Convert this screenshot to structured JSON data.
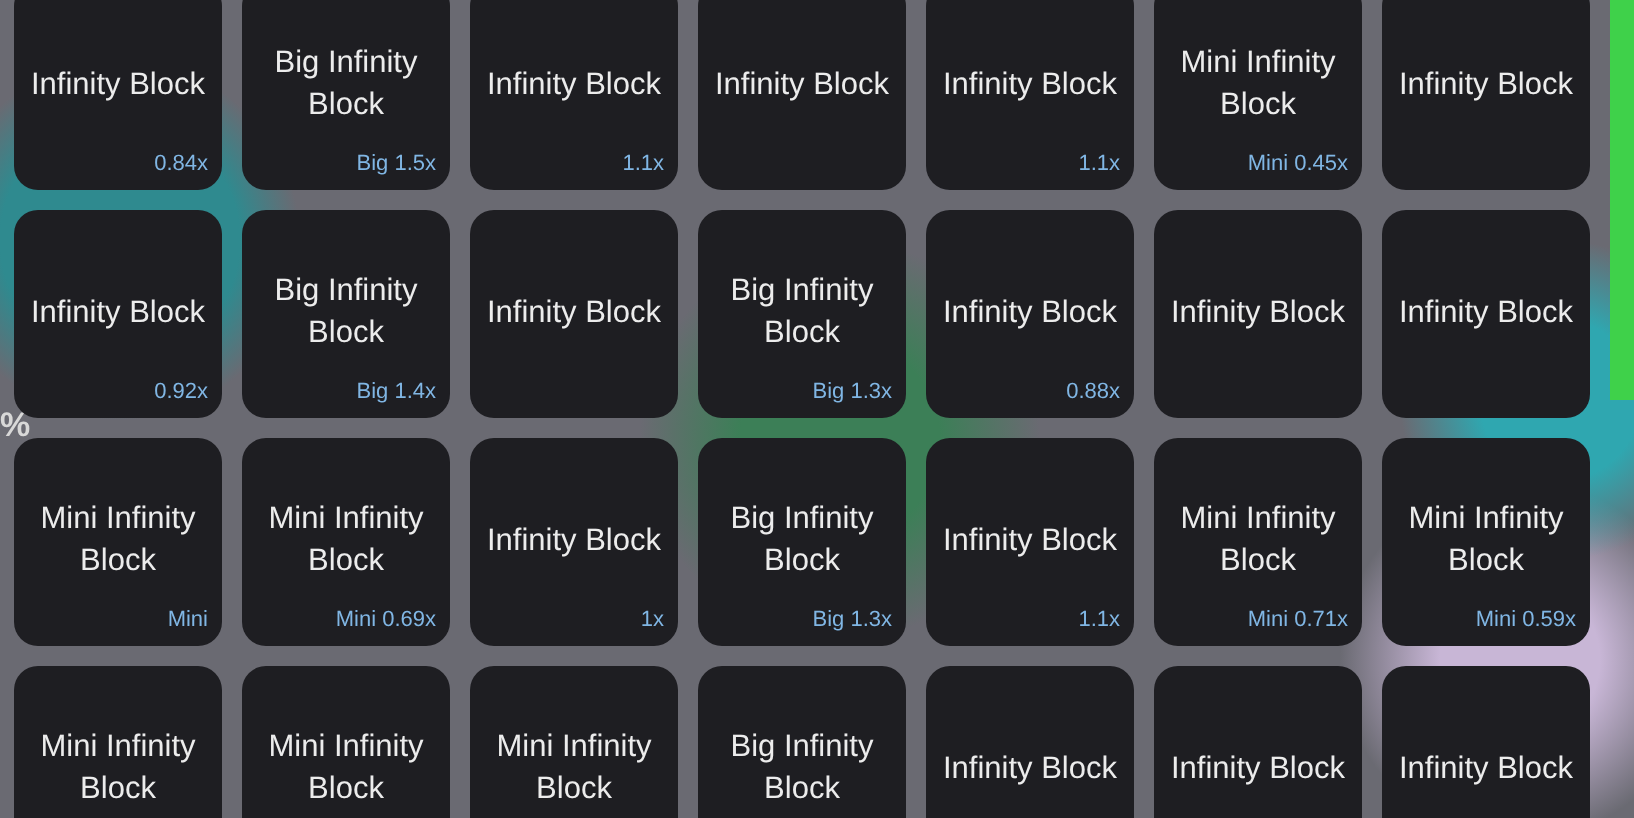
{
  "background_text": "%",
  "items": [
    {
      "name": "Infinity Block",
      "tag": "0.84x"
    },
    {
      "name": "Big Infinity Block",
      "tag": "Big 1.5x"
    },
    {
      "name": "Infinity Block",
      "tag": "1.1x"
    },
    {
      "name": "Infinity Block"
    },
    {
      "name": "Infinity Block",
      "tag": "1.1x"
    },
    {
      "name": "Mini Infinity Block",
      "tag": "Mini 0.45x"
    },
    {
      "name": "Infinity Block"
    },
    {
      "name": "Infinity Block",
      "tag": "0.92x"
    },
    {
      "name": "Big Infinity Block",
      "tag": "Big 1.4x"
    },
    {
      "name": "Infinity Block"
    },
    {
      "name": "Big Infinity Block",
      "tag": "Big 1.3x"
    },
    {
      "name": "Infinity Block",
      "tag": "0.88x"
    },
    {
      "name": "Infinity Block"
    },
    {
      "name": "Infinity Block"
    },
    {
      "name": "Mini Infinity Block",
      "tag": "Mini"
    },
    {
      "name": "Mini Infinity Block",
      "tag": "Mini 0.69x"
    },
    {
      "name": "Infinity Block",
      "tag": "1x"
    },
    {
      "name": "Big Infinity Block",
      "tag": "Big 1.3x"
    },
    {
      "name": "Infinity Block",
      "tag": "1.1x"
    },
    {
      "name": "Mini Infinity Block",
      "tag": "Mini 0.71x"
    },
    {
      "name": "Mini Infinity Block",
      "tag": "Mini 0.59x"
    },
    {
      "name": "Mini Infinity Block"
    },
    {
      "name": "Mini Infinity Block"
    },
    {
      "name": "Mini Infinity Block"
    },
    {
      "name": "Big Infinity Block"
    },
    {
      "name": "Infinity Block"
    },
    {
      "name": "Infinity Block"
    },
    {
      "name": "Infinity Block"
    }
  ]
}
